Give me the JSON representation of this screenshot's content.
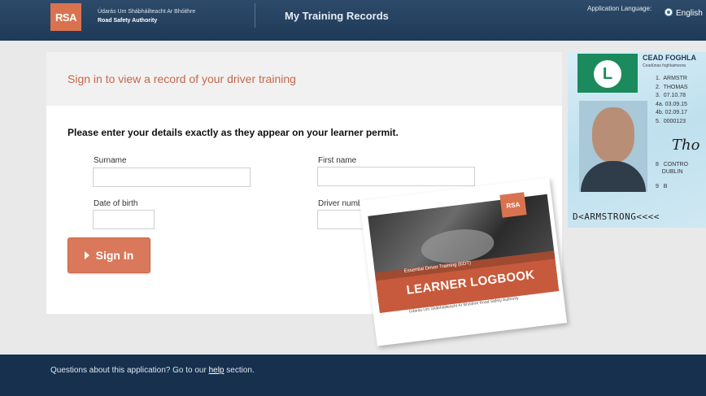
{
  "header": {
    "logo_text": "RSA",
    "org_irish": "Údarás Um Shábháilteacht Ar Bhóithre",
    "org_english": "Road Safety Authority",
    "app_title": "My Training Records",
    "language_label": "Application Language:",
    "language_value": "English"
  },
  "form": {
    "title": "Sign in to view a record of your driver training",
    "instructions": "Please enter your details exactly as they appear on your learner permit.",
    "surname_label": "Surname",
    "surname_value": "",
    "firstname_label": "First name",
    "firstname_value": "",
    "dob_label": "Date of birth",
    "dob_value": "",
    "driver_number_label": "Driver number",
    "driver_number_value": "",
    "signin_label": "Sign In"
  },
  "logbook": {
    "logo_text": "RSA",
    "subtitle": "Essential Driver Training (EDT)",
    "title": "LEARNER LOGBOOK",
    "footer": "Údarás Um Shábháilteacht Ar Bhóithre Road Safety Authority"
  },
  "permit": {
    "badge": "L",
    "heading": "CEAD FOGHLA",
    "subheading": "Ceadúnas foghlaimeora",
    "fields": "1.  ARMSTR\n2.  THOMAS\n3.  07.10.78\n4a. 03.09.15\n4b. 02.09.17\n5.  0000123",
    "signature": "Tho",
    "address": "8   CONTRO\n    DUBLIN\n\n9   B",
    "mrz": "D<ARMSTRONG<<<<"
  },
  "footer": {
    "text_before": "Questions about this application? Go to our ",
    "link": "help",
    "text_after": " section."
  }
}
